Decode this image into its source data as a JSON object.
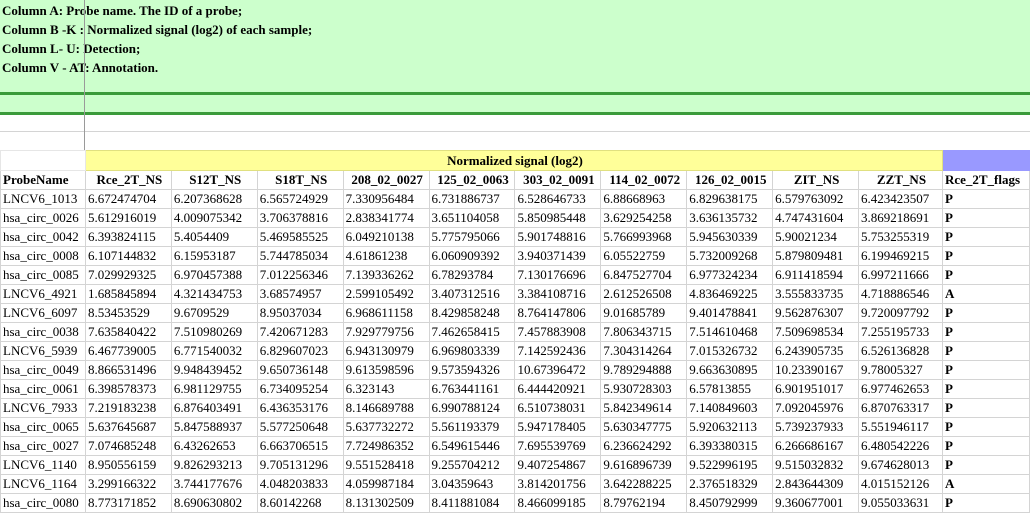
{
  "notes": [
    "Column A: Probe name. The ID of a probe;",
    "Column B -K : Normalized signal (log2) of each sample;",
    "Column L- U: Detection;",
    "Column V - AT: Annotation."
  ],
  "group_header": "Normalized signal (log2)",
  "columns": [
    "ProbeName",
    "Rce_2T_NS",
    "S12T_NS",
    "S18T_NS",
    "208_02_0027",
    "125_02_0063",
    "303_02_0091",
    "114_02_0072",
    "126_02_0015",
    "ZIT_NS",
    "ZZT_NS",
    "Rce_2T_flags"
  ],
  "rows": [
    [
      "LNCV6_1013",
      "6.672474704",
      "6.207368628",
      "6.565724929",
      "7.330956484",
      "6.731886737",
      "6.528646733",
      "6.88668963",
      "6.829638175",
      "6.579763092",
      "6.423423507",
      "P"
    ],
    [
      "hsa_circ_0026",
      "5.612916019",
      "4.009075342",
      "3.706378816",
      "2.838341774",
      "3.651104058",
      "5.850985448",
      "3.629254258",
      "3.636135732",
      "4.747431604",
      "3.869218691",
      "P"
    ],
    [
      "hsa_circ_0042",
      "6.393824115",
      "5.4054409",
      "5.469585525",
      "6.049210138",
      "5.775795066",
      "5.901748816",
      "5.766993968",
      "5.945630339",
      "5.90021234",
      "5.753255319",
      "P"
    ],
    [
      "hsa_circ_0008",
      "6.107144832",
      "6.15953187",
      "5.744785034",
      "4.61861238",
      "6.060909392",
      "3.940371439",
      "6.05522759",
      "5.732009268",
      "5.879809481",
      "6.199469215",
      "P"
    ],
    [
      "hsa_circ_0085",
      "7.029929325",
      "6.970457388",
      "7.012256346",
      "7.139336262",
      "6.78293784",
      "7.130176696",
      "6.847527704",
      "6.977324234",
      "6.911418594",
      "6.997211666",
      "P"
    ],
    [
      "LNCV6_4921",
      "1.685845894",
      "4.321434753",
      "3.68574957",
      "2.599105492",
      "3.407312516",
      "3.384108716",
      "2.612526508",
      "4.836469225",
      "3.555833735",
      "4.718886546",
      "A"
    ],
    [
      "LNCV6_6097",
      "8.53453529",
      "9.6709529",
      "8.95037034",
      "6.968611158",
      "8.429858248",
      "8.764147806",
      "9.01685789",
      "9.401478841",
      "9.562876307",
      "9.720097792",
      "P"
    ],
    [
      "hsa_circ_0038",
      "7.635840422",
      "7.510980269",
      "7.420671283",
      "7.929779756",
      "7.462658415",
      "7.457883908",
      "7.806343715",
      "7.514610468",
      "7.509698534",
      "7.255195733",
      "P"
    ],
    [
      "LNCV6_5939",
      "6.467739005",
      "6.771540032",
      "6.829607023",
      "6.943130979",
      "6.969803339",
      "7.142592436",
      "7.304314264",
      "7.015326732",
      "6.243905735",
      "6.526136828",
      "P"
    ],
    [
      "hsa_circ_0049",
      "8.866531496",
      "9.948439452",
      "9.650736148",
      "9.613598596",
      "9.573594326",
      "10.67396472",
      "9.789294888",
      "9.663630895",
      "10.23390167",
      "9.78005327",
      "P"
    ],
    [
      "hsa_circ_0061",
      "6.398578373",
      "6.981129755",
      "6.734095254",
      "6.323143",
      "6.763441161",
      "6.444420921",
      "5.930728303",
      "6.57813855",
      "6.901951017",
      "6.977462653",
      "P"
    ],
    [
      "LNCV6_7933",
      "7.219183238",
      "6.876403491",
      "6.436353176",
      "8.146689788",
      "6.990788124",
      "6.510738031",
      "5.842349614",
      "7.140849603",
      "7.092045976",
      "6.870763317",
      "P"
    ],
    [
      "hsa_circ_0065",
      "5.637645687",
      "5.847588937",
      "5.577250648",
      "5.637732272",
      "5.561193379",
      "5.947178405",
      "5.630347775",
      "5.920632113",
      "5.739237933",
      "5.551946117",
      "P"
    ],
    [
      "hsa_circ_0027",
      "7.074685248",
      "6.43262653",
      "6.663706515",
      "7.724986352",
      "6.549615446",
      "7.695539769",
      "6.236624292",
      "6.393380315",
      "6.266686167",
      "6.480542226",
      "P"
    ],
    [
      "LNCV6_1140",
      "8.950556159",
      "9.826293213",
      "9.705131296",
      "9.551528418",
      "9.255704212",
      "9.407254867",
      "9.616896739",
      "9.522996195",
      "9.515032832",
      "9.674628013",
      "P"
    ],
    [
      "LNCV6_1164",
      "3.299166322",
      "3.744177676",
      "4.048203833",
      "4.059987184",
      "3.04359643",
      "3.814201756",
      "3.642288225",
      "2.376518329",
      "2.843644309",
      "4.015152126",
      "A"
    ],
    [
      "hsa_circ_0080",
      "8.773171852",
      "8.690630802",
      "8.60142268",
      "8.131302509",
      "8.411881084",
      "8.466099185",
      "8.79762194",
      "8.450792999",
      "9.360677001",
      "9.055033631",
      "P"
    ]
  ]
}
